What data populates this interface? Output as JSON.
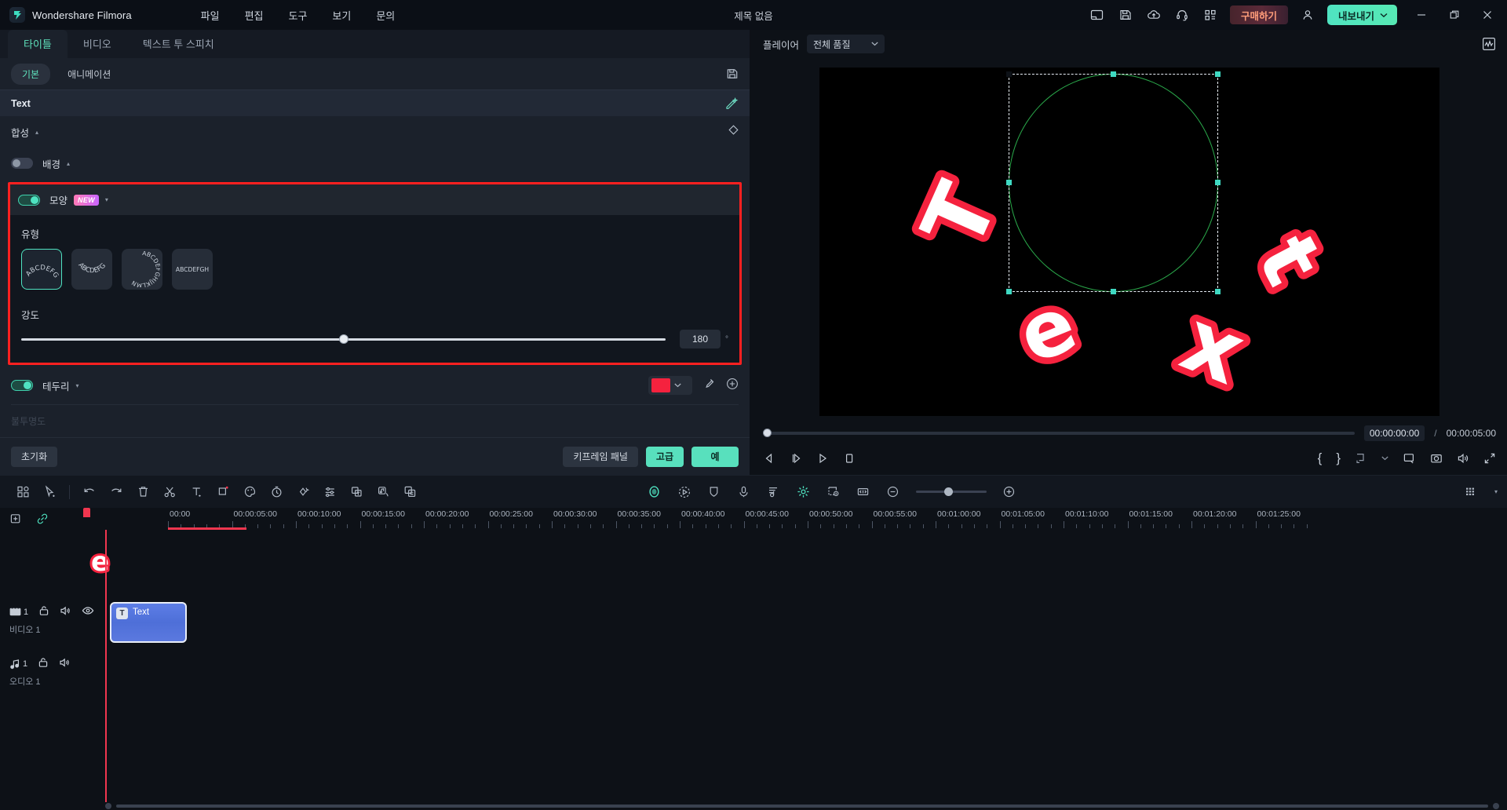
{
  "titlebar": {
    "brand": "Wondershare Filmora",
    "menu": [
      "파일",
      "편집",
      "도구",
      "보기",
      "문의"
    ],
    "project_title": "제목 없음",
    "icons": [
      "panel-layout-icon",
      "save-icon",
      "cloud-upload-icon",
      "headset-support-icon",
      "apps-grid-icon"
    ],
    "buy_label": "구매하기",
    "account_icon": "account-icon",
    "export_label": "내보내기",
    "window": {
      "minimize": "—",
      "maximize": "❐",
      "close": "✕"
    }
  },
  "left_panel": {
    "tabs": [
      {
        "label": "타이틀",
        "active": true
      },
      {
        "label": "비디오",
        "active": false
      },
      {
        "label": "텍스트 투 스피치",
        "active": false
      }
    ],
    "subtabs": [
      {
        "label": "기본",
        "active": true
      },
      {
        "label": "애니메이션",
        "active": false
      }
    ],
    "save_preset_icon": "save-preset-icon",
    "object_title": "Text",
    "ai_icon": "ai-magic-icon",
    "composite": {
      "label": "합성",
      "caret": "▴",
      "diamond_icon": "keyframe-diamond-icon"
    },
    "background": {
      "label": "배경",
      "caret": "▴",
      "enabled": false
    },
    "shape": {
      "label": "모양",
      "badge": "NEW",
      "caret": "▾",
      "enabled": true,
      "type_label": "유형",
      "types": [
        {
          "name": "arc-up",
          "selected": true,
          "preview": "ABCDEFG"
        },
        {
          "name": "arc-down",
          "selected": false,
          "preview": "ABCDEFG"
        },
        {
          "name": "circle-full",
          "selected": false,
          "preview": "ABCDEFGHIJKLMN"
        },
        {
          "name": "flat",
          "selected": false,
          "preview": "ABCDEFGH"
        }
      ],
      "intensity_label": "강도",
      "intensity_value": "180",
      "intensity_unit": "°",
      "intensity_pct": 50
    },
    "border": {
      "label": "테두리",
      "caret": "▾",
      "enabled": true,
      "color": "#f5223e",
      "dropdown_icon": "chevron-down-icon",
      "eyedropper_icon": "eyedropper-icon",
      "add_icon": "add-circle-icon"
    },
    "opacity_label": "불투명도",
    "footer": {
      "reset_label": "초기화",
      "keyframe_panel_label": "키프레임 패널",
      "advanced_label": "고급",
      "ok_label": "예"
    }
  },
  "player": {
    "label": "플레이어",
    "quality": "전체 품질",
    "quality_caret": "⌄",
    "scope_icon": "waveform-scope-icon",
    "current_time": "00:00:00:00",
    "separator": "/",
    "total_time": "00:00:05:00",
    "canvas_text": [
      "T",
      "e",
      "x",
      "t"
    ],
    "controls_left": [
      "prev-frame-icon",
      "step-forward-icon",
      "play-icon",
      "stop-icon"
    ],
    "controls_right": [
      "mark-in-icon",
      "mark-out-icon",
      "export-frame-icon",
      "chevron-down-icon",
      "crop-icon",
      "snapshot-icon",
      "volume-icon",
      "fullscreen-icon"
    ],
    "mark_in": "{",
    "mark_out": "}"
  },
  "timeline": {
    "toolbar_left": [
      "media-grid-icon",
      "select-tool-icon",
      "undo-icon",
      "redo-icon",
      "delete-icon",
      "split-scissors-icon",
      "text-icon",
      "crop-icon",
      "color-icon",
      "speed-icon",
      "keyframe-icon",
      "adjust-sliders-icon",
      "mask-text-icon",
      "audio-detach-icon",
      "auto-caption-icon"
    ],
    "toolbar_center": [
      "face-mosaic-icon",
      "motion-tracking-icon",
      "shape-mask-icon",
      "mic-record-icon",
      "beat-detect-icon",
      "ai-effect-icon",
      "green-screen-icon",
      "fit-timeline-icon"
    ],
    "zoom_minus": "−",
    "zoom_plus": "+",
    "render_icon": "render-bar-icon",
    "more_caret": "▾",
    "subbar_icons": [
      "marker-add-icon",
      "link-icon"
    ],
    "ruler_labels": [
      "00:00",
      "00:00:05:00",
      "00:00:10:00",
      "00:00:15:00",
      "00:00:20:00",
      "00:00:25:00",
      "00:00:30:00",
      "00:00:35:00",
      "00:00:40:00",
      "00:00:45:00",
      "00:00:50:00",
      "00:00:55:00",
      "00:01:00:00",
      "00:01:05:00",
      "00:01:10:00",
      "00:01:15:00",
      "00:01:20:00",
      "00:01:25:00"
    ],
    "tracks": [
      {
        "kind": "video",
        "icon": "video-track-icon",
        "index": "1",
        "name": "비디오 1",
        "controls": [
          "lock-icon",
          "mute-icon",
          "eye-icon"
        ],
        "clip": {
          "label": "Text",
          "icon": "T"
        }
      },
      {
        "kind": "audio",
        "icon": "audio-track-icon",
        "index": "1",
        "name": "오디오 1",
        "controls": [
          "lock-icon",
          "mute-icon"
        ],
        "clip": null
      }
    ]
  }
}
